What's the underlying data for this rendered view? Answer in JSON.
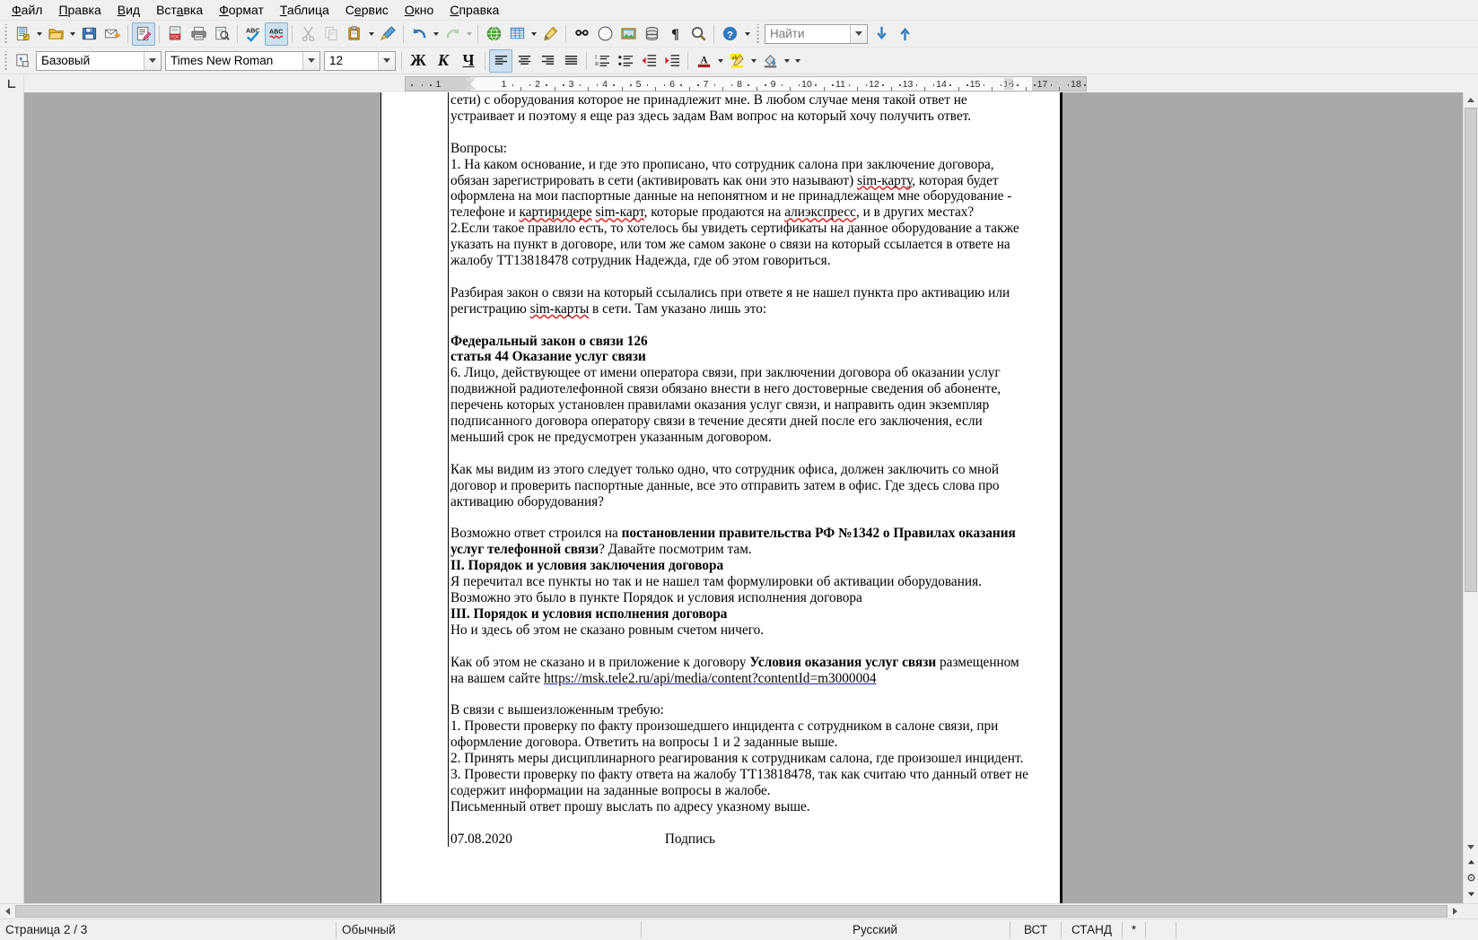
{
  "menu": {
    "items": [
      {
        "label": "Файл",
        "accel": "Ф"
      },
      {
        "label": "Правка",
        "accel": "П"
      },
      {
        "label": "Вид",
        "accel": "В"
      },
      {
        "label": "Вставка",
        "accel": "а"
      },
      {
        "label": "Формат",
        "accel": "Ф"
      },
      {
        "label": "Таблица",
        "accel": "Т"
      },
      {
        "label": "Сервис",
        "accel": "е"
      },
      {
        "label": "Окно",
        "accel": "О"
      },
      {
        "label": "Справка",
        "accel": "С"
      }
    ]
  },
  "toolbar_standard": {
    "buttons": [
      {
        "name": "new-document-icon",
        "tooltip": "Создать"
      },
      {
        "name": "open-document-icon",
        "tooltip": "Открыть"
      },
      {
        "name": "save-document-icon",
        "tooltip": "Сохранить"
      },
      {
        "name": "email-document-icon",
        "tooltip": "Отправить по электронной почте"
      },
      {
        "name": "edit-mode-icon",
        "tooltip": "Режим правки"
      },
      {
        "name": "export-pdf-icon",
        "tooltip": "Экспорт в PDF"
      },
      {
        "name": "print-icon",
        "tooltip": "Печать"
      },
      {
        "name": "print-preview-icon",
        "tooltip": "Предварительный просмотр"
      },
      {
        "name": "spelling-icon",
        "tooltip": "Проверка орфографии"
      },
      {
        "name": "autospellcheck-icon",
        "tooltip": "Автопроверка орфографии"
      },
      {
        "name": "cut-icon",
        "tooltip": "Вырезать"
      },
      {
        "name": "copy-icon",
        "tooltip": "Копировать"
      },
      {
        "name": "paste-icon",
        "tooltip": "Вставить"
      },
      {
        "name": "clone-formatting-icon",
        "tooltip": "Клонировать форматирование"
      },
      {
        "name": "undo-icon",
        "tooltip": "Отменить"
      },
      {
        "name": "redo-icon",
        "tooltip": "Вернуть"
      },
      {
        "name": "insert-hyperlink-icon",
        "tooltip": "Гиперссылка"
      },
      {
        "name": "insert-table-icon",
        "tooltip": "Вставить таблицу"
      },
      {
        "name": "draw-functions-icon",
        "tooltip": "Функции рисования"
      },
      {
        "name": "find-replace-icon",
        "tooltip": "Найти и заменить"
      },
      {
        "name": "navigator-icon",
        "tooltip": "Навигатор"
      },
      {
        "name": "insert-image-icon",
        "tooltip": "Вставить изображение"
      },
      {
        "name": "data-sources-icon",
        "tooltip": "Источники данных"
      },
      {
        "name": "formatting-marks-icon",
        "tooltip": "Непечатаемые символы"
      },
      {
        "name": "zoom-icon",
        "tooltip": "Масштаб"
      },
      {
        "name": "help-icon",
        "tooltip": "Справка"
      }
    ]
  },
  "find_toolbar": {
    "placeholder": "Найти",
    "value": "",
    "find_next_icon": "arrow-down-icon",
    "find_prev_icon": "arrow-up-icon"
  },
  "toolbar_formatting": {
    "paragraph_style_icon": "paragraph-style-icon",
    "paragraph_style": "Базовый",
    "font_name": "Times New Roman",
    "font_size": "12",
    "bold_label": "Ж",
    "italic_label": "К",
    "underline_label": "Ч",
    "align": {
      "left": "align-left-icon",
      "center": "align-center-icon",
      "right": "align-right-icon",
      "justify": "align-justify-icon",
      "active": "left"
    },
    "lists": {
      "ordered": "ordered-list-icon",
      "unordered": "unordered-list-icon",
      "decrease_indent": "decrease-indent-icon",
      "increase_indent": "increase-indent-icon"
    },
    "font_color_icon": "font-color-icon",
    "highlight_color_icon": "highlight-color-icon",
    "background_color_icon": "background-color-icon"
  },
  "ruler": {
    "unit_labels_left": [
      "1"
    ],
    "labels": [
      "1",
      "2",
      "3",
      "4",
      "5",
      "6",
      "7",
      "8",
      "9",
      "10",
      "11",
      "12",
      "13",
      "14",
      "15",
      "16",
      "17",
      "18"
    ],
    "first_line_indent_marker": "indent-marker-icon",
    "right_indent_marker": "indent-marker-icon"
  },
  "document": {
    "paragraphs": [
      {
        "type": "p",
        "runs": [
          {
            "t": "сети) с оборудования которое не принадлежит мне. В любом случае меня такой ответ не устраивает и поэтому я еще раз здесь задам Вам вопрос на который хочу получить ответ."
          }
        ]
      },
      {
        "type": "spacer"
      },
      {
        "type": "p",
        "runs": [
          {
            "t": "Вопросы:"
          }
        ]
      },
      {
        "type": "p",
        "runs": [
          {
            "t": "1. На каком основание, и где это прописано, что сотрудник салона при заключение договора, обязан зарегистрировать в сети (активировать как они это называют) "
          },
          {
            "t": "sim-карту",
            "style": "squiggle"
          },
          {
            "t": ", которая будет оформлена на мои паспортные данные на непонятном и  не принадлежащем мне оборудование - телефоне  и "
          },
          {
            "t": "картиридере",
            "style": "squiggle"
          },
          {
            "t": " "
          },
          {
            "t": "sim-карт",
            "style": "squiggle"
          },
          {
            "t": ", которые продаются на "
          },
          {
            "t": "алиэкспресс",
            "style": "squiggle"
          },
          {
            "t": ", и в других местах?"
          }
        ]
      },
      {
        "type": "p",
        "runs": [
          {
            "t": "2.Если такое правило есть, то хотелось бы увидеть сертификаты на данное оборудование а также  указать на  пункт в договоре, или том же самом законе о связи на который ссылается в ответе  на жалобу ТТ13818478 сотрудник Надежда, где об этом говориться."
          }
        ]
      },
      {
        "type": "spacer"
      },
      {
        "type": "p",
        "runs": [
          {
            "t": "Разбирая закон о связи на который ссылались при ответе я не нашел пункта про активацию или регистрацию "
          },
          {
            "t": "sim-карты",
            "style": "squiggle"
          },
          {
            "t": " в сети. Там указано лишь это:"
          }
        ]
      },
      {
        "type": "spacer"
      },
      {
        "type": "p",
        "runs": [
          {
            "t": "Федеральный закон о связи 126",
            "style": "bold"
          }
        ]
      },
      {
        "type": "p",
        "runs": [
          {
            "t": "статья 44 Оказание услуг связи",
            "style": "bold"
          }
        ]
      },
      {
        "type": "p",
        "runs": [
          {
            "t": "6. Лицо, действующее от имени оператора связи, при заключении договора об оказании услуг подвижной радиотелефонной связи обязано внести в него достоверные сведения об абоненте, перечень которых установлен правилами оказания услуг связи, и направить один экземпляр подписанного договора оператору связи в течение десяти дней после его заключения, если меньший срок не предусмотрен указанным договором."
          }
        ]
      },
      {
        "type": "spacer"
      },
      {
        "type": "p",
        "runs": [
          {
            "t": "Как мы видим из этого следует только одно, что сотрудник офиса, должен заключить со мной договор и проверить паспортные данные, все это отправить затем в офис. Где здесь слова про активацию оборудования?"
          }
        ]
      },
      {
        "type": "spacer"
      },
      {
        "type": "p",
        "runs": [
          {
            "t": "Возможно ответ строился на "
          },
          {
            "t": "постановлении правительства РФ  №1342 о Правилах оказания услуг телефонной связи",
            "style": "bold"
          },
          {
            "t": "? Давайте посмотрим там."
          }
        ]
      },
      {
        "type": "p",
        "runs": [
          {
            "t": "II. Порядок и условия заключения договора",
            "style": "bold"
          }
        ]
      },
      {
        "type": "p",
        "runs": [
          {
            "t": "Я перечитал все пункты но так и не нашел там формулировки об активации оборудования. Возможно это было в пункте Порядок и условия исполнения договора"
          }
        ]
      },
      {
        "type": "p",
        "runs": [
          {
            "t": "III. Порядок и условия исполнения договора",
            "style": "bold"
          }
        ]
      },
      {
        "type": "p",
        "runs": [
          {
            "t": "Но и здесь об этом не сказано ровным счетом ничего."
          }
        ]
      },
      {
        "type": "spacer"
      },
      {
        "type": "p",
        "runs": [
          {
            "t": "Как об этом не сказано и в приложение к договору "
          },
          {
            "t": "Условия оказания услуг связи",
            "style": "bold"
          },
          {
            "t": " размещенном на вашем сайте "
          },
          {
            "t": "https://msk.tele2.ru/api/media/content?contentId=m3000004",
            "style": "link"
          }
        ]
      },
      {
        "type": "spacer"
      },
      {
        "type": "p",
        "runs": [
          {
            "t": "В связи с вышеизложенным требую:"
          }
        ]
      },
      {
        "type": "p",
        "runs": [
          {
            "t": "1. Провести проверку по факту произошедшего инцидента с сотрудником в салоне связи, при оформление договора. Ответить на вопросы 1 и 2 заданные выше."
          }
        ]
      },
      {
        "type": "p",
        "runs": [
          {
            "t": "2. Принять меры дисциплинарного реагирования к сотрудникам салона, где произошел инцидент."
          }
        ]
      },
      {
        "type": "p",
        "runs": [
          {
            "t": "3. Провести проверку по факту ответа на жалобу  ТТ13818478, так как считаю что данный ответ не содержит информации на заданные вопросы в жалобе."
          }
        ]
      },
      {
        "type": "p",
        "runs": [
          {
            "t": "Письменный ответ прошу выслать по адресу указному выше."
          }
        ]
      },
      {
        "type": "spacer"
      },
      {
        "type": "signature_line",
        "date": "07.08.2020",
        "label": "Подпись"
      }
    ]
  },
  "statusbar": {
    "page": "Страница  2 / 3",
    "page_style": "Обычный",
    "language": "Русский",
    "insert_mode": "ВСТ",
    "selection_mode": "СТАНД",
    "modified": "*"
  },
  "colors": {
    "window_bg": "#f0f0f0",
    "canvas_bg": "#a9a9a9",
    "page_bg": "#ffffff",
    "accent_highlight": "#cde0f0",
    "spell_error": "#d62828",
    "hyperlink_underline": "#1a2fbe"
  }
}
